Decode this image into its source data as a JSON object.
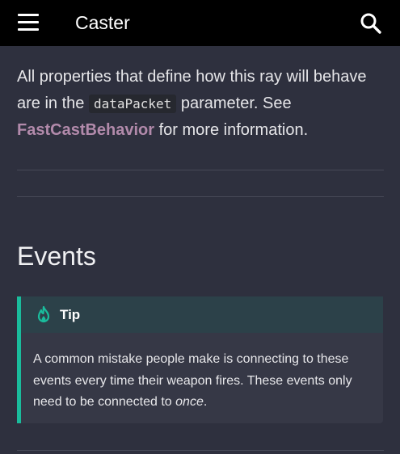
{
  "header": {
    "title": "Caster",
    "menu_icon": "menu-icon",
    "search_icon": "search-icon"
  },
  "intro": {
    "part1": "All properties that define how this ray will behave are in the",
    "code": "dataPacket",
    "part2": "parameter. See",
    "link": "FastCastBehavior",
    "part3": "for more information."
  },
  "section": {
    "title": "Events"
  },
  "tip": {
    "icon": "flame-icon",
    "title": "Tip",
    "body_main": "A common mistake people make is connecting to these events every time their weapon fires. These events only need to be connected to",
    "body_em": "once",
    "body_end": "."
  },
  "colors": {
    "header_bg": "#000000",
    "page_bg": "#2e303e",
    "link": "#b28aab",
    "tip_accent": "#1abc9c",
    "tip_head_bg": "#2c4149"
  }
}
